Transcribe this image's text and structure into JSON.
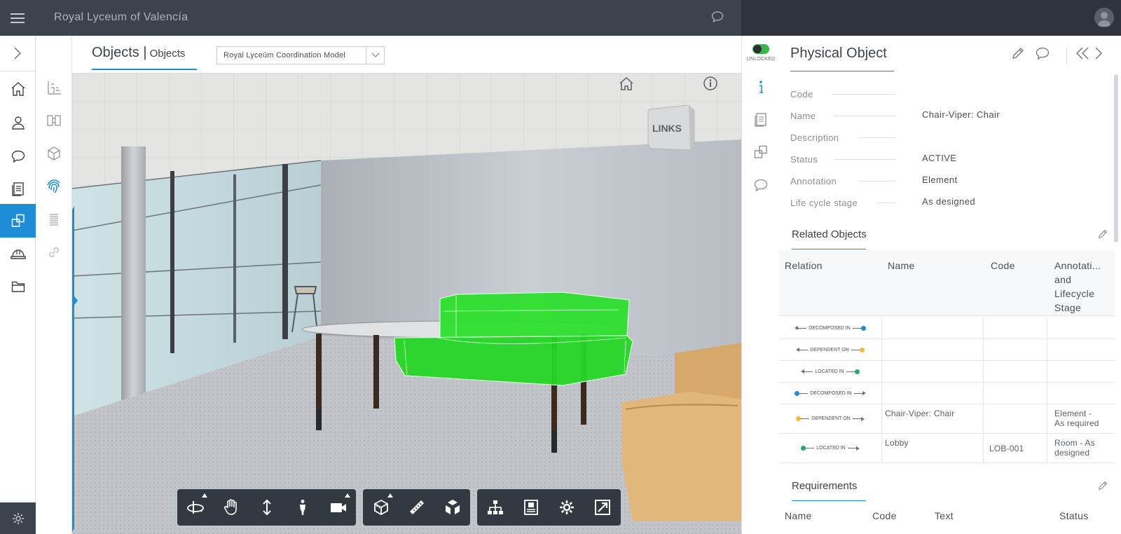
{
  "app": {
    "title": "Royal Lyceum of Valencía"
  },
  "viewer": {
    "title": "Objects",
    "subtitle": "Objects",
    "model_select": "Royal Lyceúm Coordination Model",
    "cube_label": "LINKS",
    "toolbar": [
      [
        "orbit-icon",
        "pan-hand-icon",
        "zoom-vertical-icon",
        "walk-person-icon",
        "camera-icon"
      ],
      [
        "section-box-icon",
        "measure-ruler-icon",
        "explode-cubes-icon"
      ],
      [
        "model-tree-icon",
        "properties-panel-icon",
        "settings-gear-icon",
        "fullscreen-icon"
      ]
    ]
  },
  "lock": {
    "label": "UNLOCKED"
  },
  "panel": {
    "title": "Physical Object",
    "properties": [
      {
        "label": "Code",
        "value": ""
      },
      {
        "label": "Name",
        "value": "Chair-Viper: Chair"
      },
      {
        "label": "Description",
        "value": ""
      },
      {
        "label": "Status",
        "value": "ACTIVE"
      },
      {
        "label": "Annotation",
        "value": "Element"
      },
      {
        "label": "Life cycle stage",
        "value": "As designed"
      }
    ],
    "related": {
      "title": "Related Objects",
      "headers": [
        "Relation",
        "Name",
        "Code",
        "Annotati...",
        "and",
        "Lifecycle",
        "Stage"
      ],
      "rows": [
        {
          "relation": "DECOMPOSED IN",
          "direction": "in",
          "color": "#1f8dd6",
          "name": "",
          "code": "",
          "annotation": "",
          "annotation2": ""
        },
        {
          "relation": "DEPENDENT ON",
          "direction": "in",
          "color": "#f5b942",
          "name": "",
          "code": "",
          "annotation": "",
          "annotation2": ""
        },
        {
          "relation": "LOCATED IN",
          "direction": "in",
          "color": "#2aa86a",
          "name": "",
          "code": "",
          "annotation": "",
          "annotation2": ""
        },
        {
          "relation": "DECOMPOSED IN",
          "direction": "out",
          "color": "#1f8dd6",
          "name": "",
          "code": "",
          "annotation": "",
          "annotation2": ""
        },
        {
          "relation": "DEPENDENT ON",
          "direction": "out",
          "color": "#f5b942",
          "name": "Chair-Viper: Chair",
          "code": "",
          "annotation": "Element -",
          "annotation2": "As required"
        },
        {
          "relation": "LOCATED IN",
          "direction": "out",
          "color": "#2aa86a",
          "name": "Lobby",
          "code": "LOB-001",
          "annotation": "Room - As",
          "annotation2": "designed"
        }
      ]
    },
    "requirements": {
      "title": "Requirements",
      "headers": [
        "Name",
        "Code",
        "Text",
        "Status"
      ]
    }
  },
  "colors": {
    "accent": "#1f8dd6",
    "topbar": "#3d434d",
    "highlight": "#2ee02e"
  }
}
